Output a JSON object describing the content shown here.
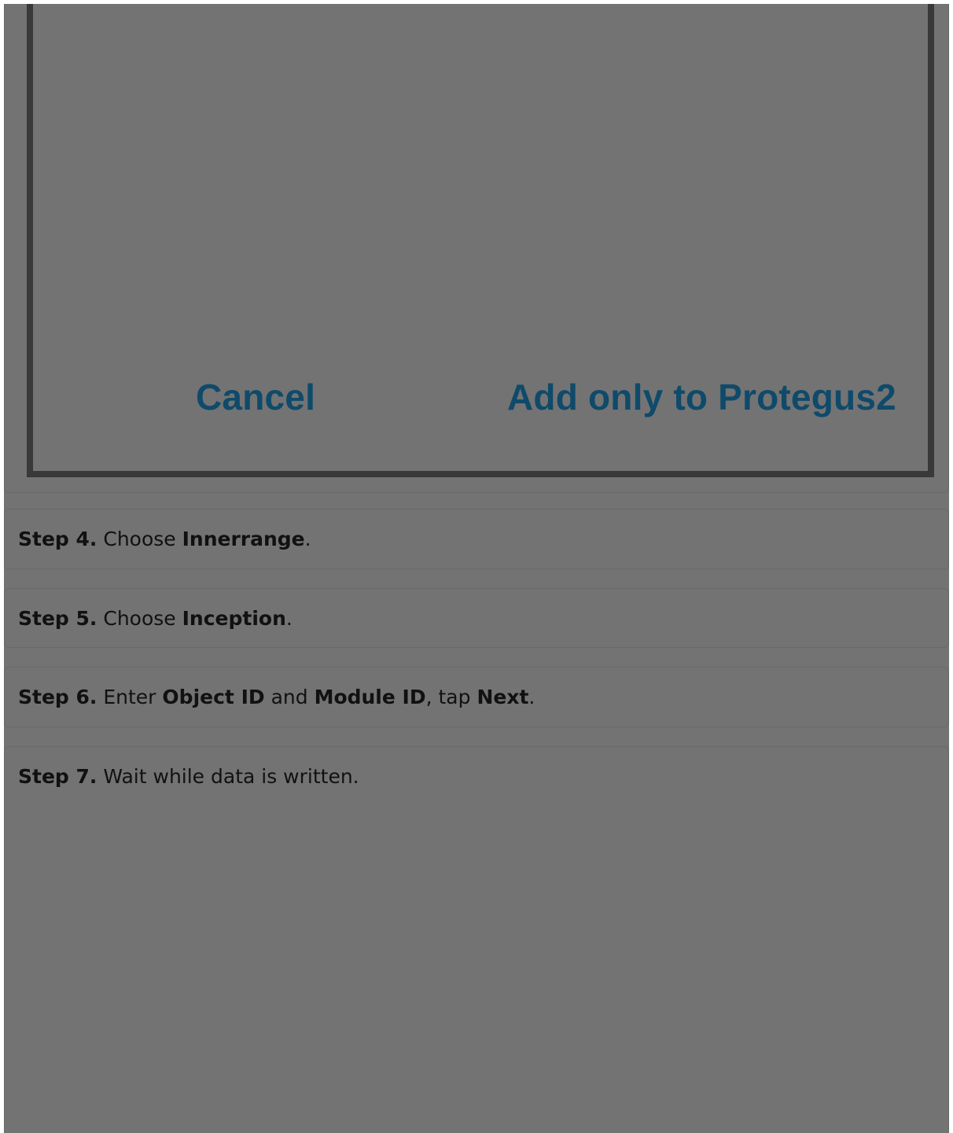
{
  "dialog": {
    "cancel_label": "Cancel",
    "add_label": "Add only to Protegus2"
  },
  "steps": [
    {
      "label": "Step 4.",
      "parts": [
        "Choose ",
        "Innerrange",
        "."
      ]
    },
    {
      "label": "Step 5.",
      "parts": [
        "Choose ",
        "Inception",
        "."
      ]
    },
    {
      "label": "Step 6.",
      "parts": [
        "Enter ",
        "Object ID",
        " and ",
        "Module ID",
        ", tap ",
        "Next",
        "."
      ]
    },
    {
      "label": "Step 7.",
      "parts": [
        "Wait while data is written."
      ]
    }
  ],
  "colors": {
    "overlay": "#737373",
    "dialog_border": "#393939",
    "dialog_button_text": "#0f4a6a"
  }
}
